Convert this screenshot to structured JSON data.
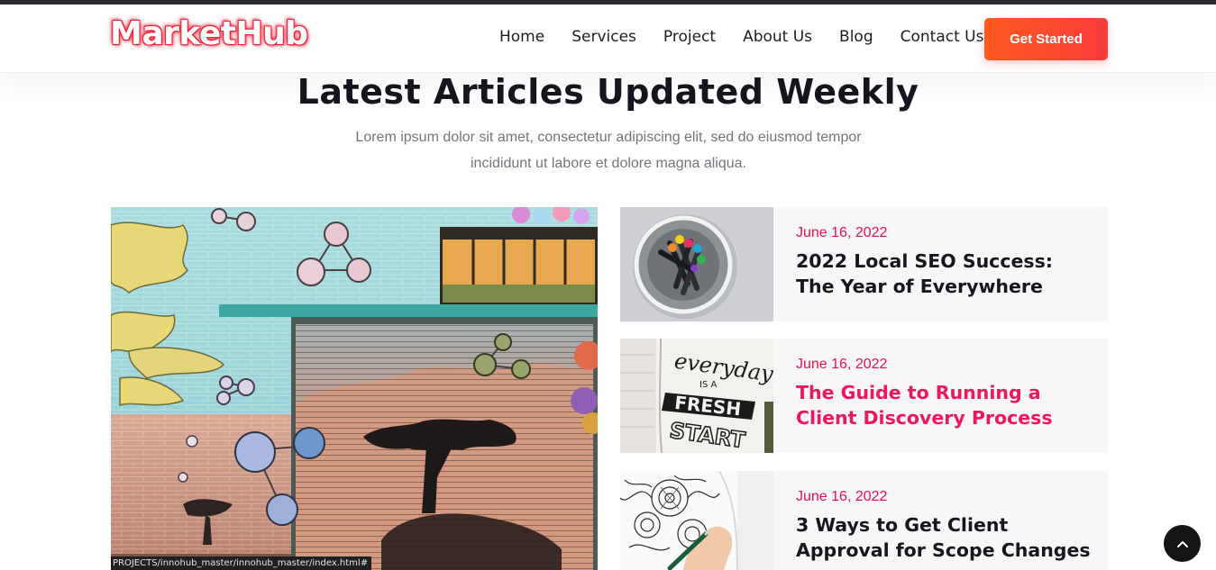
{
  "header": {
    "logo": "MarketHub",
    "nav": [
      {
        "label": "Home"
      },
      {
        "label": "Services"
      },
      {
        "label": "Project"
      },
      {
        "label": "About Us"
      },
      {
        "label": "Blog"
      },
      {
        "label": "Contact Us"
      }
    ],
    "cta_label": "Get Started"
  },
  "section": {
    "title": "Latest Articles Updated Weekly",
    "subtitle": "Lorem ipsum dolor sit amet, consectetur adipiscing elit, sed do eiusmod tempor incididunt ut labore et dolore magna aliqua."
  },
  "status_bar": {
    "url": "PROJECTS/innohub_master/innohub_master/index.html#"
  },
  "articles": [
    {
      "date": "June 16, 2022",
      "title": "2022 Local SEO Success: The Year of Everywhere"
    },
    {
      "date": "June 16, 2022",
      "title": "The Guide to Running a Client Discovery Process"
    },
    {
      "date": "June 16, 2022",
      "title": "3 Ways to Get Client Approval for Scope Changes"
    }
  ],
  "images": {
    "feature": "graffiti-wall-image",
    "thumb1": "markers-cup-image",
    "thumb2": "everyday-fresh-start-notebook-image",
    "thumb3": "mandala-drawing-image"
  },
  "colors": {
    "accent": "#e3124f",
    "cta_gradient_start": "#ff5a1f",
    "cta_gradient_end": "#f93b3b",
    "active_title": "#ee175a"
  },
  "icons": {
    "scroll_top": "chevron-up-icon"
  }
}
